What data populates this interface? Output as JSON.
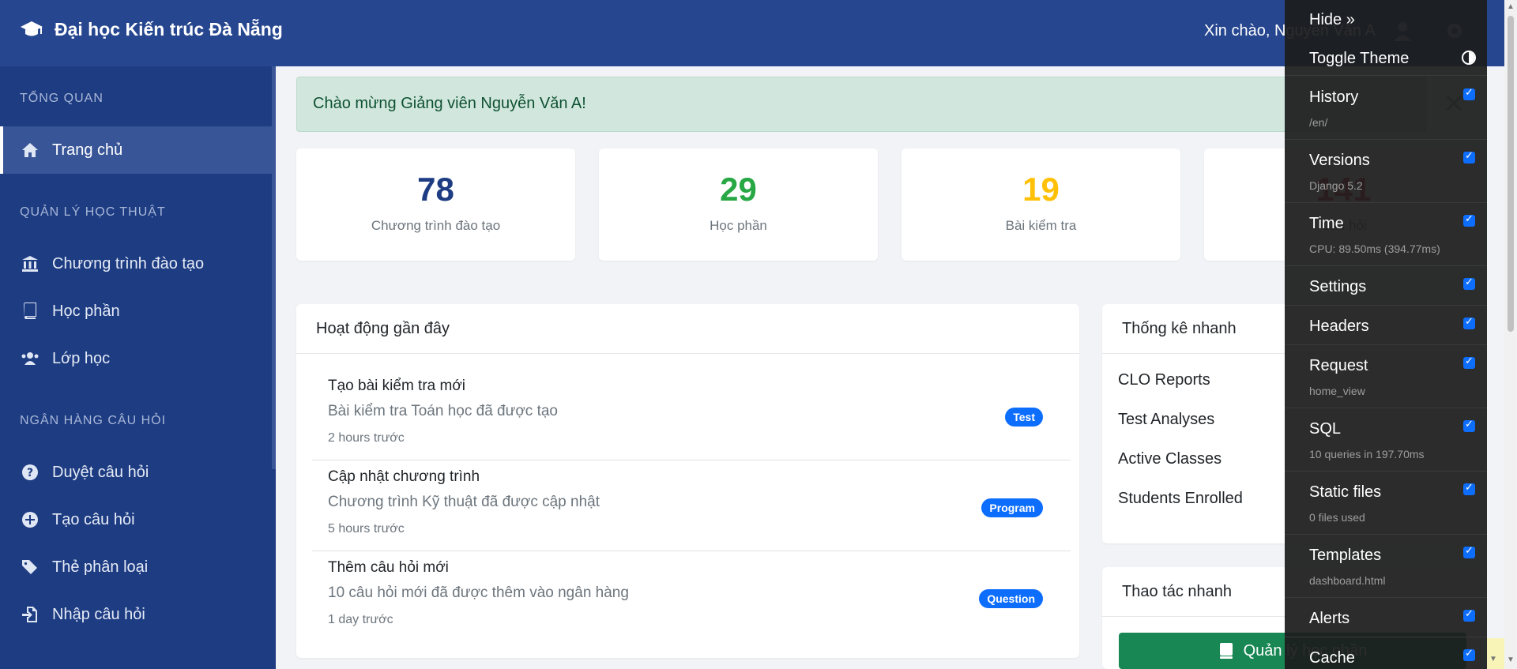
{
  "brand": {
    "title": "Đại học Kiến trúc Đà Nẵng",
    "icon": "graduation-cap-icon"
  },
  "header": {
    "greeting": "Xin chào, Nguyễn Văn A"
  },
  "sidebar": {
    "sections": [
      {
        "title": "TỔNG QUAN"
      },
      {
        "title": "QUẢN LÝ HỌC THUẬT"
      },
      {
        "title": "NGÂN HÀNG CÂU HỎI"
      }
    ],
    "items": [
      {
        "label": "Trang chủ",
        "icon": "home-icon",
        "active": true
      },
      {
        "label": "Chương trình đào tạo",
        "icon": "university-icon"
      },
      {
        "label": "Học phần",
        "icon": "book-icon"
      },
      {
        "label": "Lớp học",
        "icon": "users-icon"
      },
      {
        "label": "Duyệt câu hỏi",
        "icon": "question-circle-icon"
      },
      {
        "label": "Tạo câu hỏi",
        "icon": "plus-circle-icon"
      },
      {
        "label": "Thẻ phân loại",
        "icon": "tags-icon"
      },
      {
        "label": "Nhập câu hỏi",
        "icon": "file-import-icon"
      }
    ]
  },
  "alert": {
    "text": "Chào mừng Giảng viên Nguyễn Văn A!"
  },
  "stats": [
    {
      "value": "78",
      "label": "Chương trình đào tạo",
      "color": "#1d3c82"
    },
    {
      "value": "29",
      "label": "Học phần",
      "color": "#28a745"
    },
    {
      "value": "19",
      "label": "Bài kiểm tra",
      "color": "#ffc107"
    },
    {
      "value": "141",
      "label": "Câu hỏi",
      "color": "#dc3545"
    }
  ],
  "activity": {
    "title": "Hoạt động gần đây",
    "items": [
      {
        "title": "Tạo bài kiểm tra mới",
        "desc": "Bài kiểm tra Toán học đã được tạo",
        "time": "2 hours trước",
        "badge": "Test"
      },
      {
        "title": "Cập nhật chương trình",
        "desc": "Chương trình Kỹ thuật đã được cập nhật",
        "time": "5 hours trước",
        "badge": "Program"
      },
      {
        "title": "Thêm câu hỏi mới",
        "desc": "10 câu hỏi mới đã được thêm vào ngân hàng",
        "time": "1 day trước",
        "badge": "Question"
      }
    ]
  },
  "quick_stats": {
    "title": "Thống kê nhanh",
    "rows": [
      {
        "label": "CLO Reports"
      },
      {
        "label": "Test Analyses"
      },
      {
        "label": "Active Classes"
      },
      {
        "label": "Students Enrolled"
      }
    ]
  },
  "quick_actions": {
    "title": "Thao tác nhanh",
    "button": "Quản lý học phần"
  },
  "debug_toolbar": {
    "hide": "Hide »",
    "toggle_theme": "Toggle Theme",
    "panels": [
      {
        "name": "History",
        "sub": "/en/"
      },
      {
        "name": "Versions",
        "sub": "Django 5.2"
      },
      {
        "name": "Time",
        "sub": "CPU: 89.50ms (394.77ms)"
      },
      {
        "name": "Settings",
        "sub": ""
      },
      {
        "name": "Headers",
        "sub": ""
      },
      {
        "name": "Request",
        "sub": "home_view"
      },
      {
        "name": "SQL",
        "sub": "10 queries in 197.70ms"
      },
      {
        "name": "Static files",
        "sub": "0 files used"
      },
      {
        "name": "Templates",
        "sub": "dashboard.html"
      },
      {
        "name": "Alerts",
        "sub": ""
      },
      {
        "name": "Cache",
        "sub": ""
      }
    ]
  }
}
